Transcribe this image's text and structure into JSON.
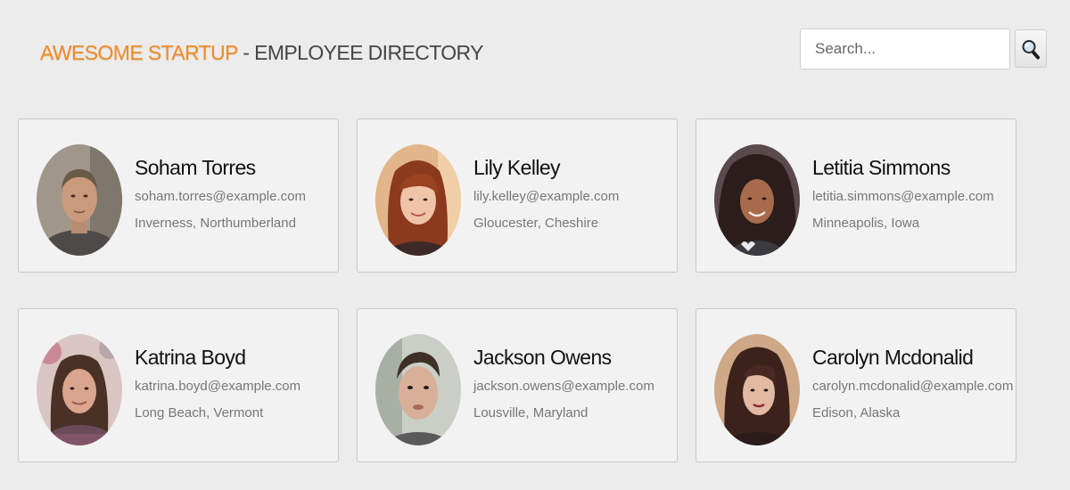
{
  "header": {
    "brand": "AWESOME STARTUP",
    "separator": " - ",
    "title": "EMPLOYEE DIRECTORY"
  },
  "search": {
    "placeholder": "Search...",
    "value": "",
    "icon": "magnifier-icon"
  },
  "colors": {
    "brand": "#f28b26",
    "background": "#ececec",
    "card": "#f2f2f2"
  },
  "employees": [
    {
      "name": "Soham Torres",
      "email": "soham.torres@example.com",
      "location": "Inverness, Northumberland"
    },
    {
      "name": "Lily Kelley",
      "email": "lily.kelley@example.com",
      "location": "Gloucester, Cheshire"
    },
    {
      "name": "Letitia Simmons",
      "email": "letitia.simmons@example.com",
      "location": "Minneapolis, Iowa"
    },
    {
      "name": "Katrina Boyd",
      "email": "katrina.boyd@example.com",
      "location": "Long Beach, Vermont"
    },
    {
      "name": "Jackson Owens",
      "email": "jackson.owens@example.com",
      "location": "Lousville, Maryland"
    },
    {
      "name": "Carolyn Mcdonalid",
      "email": "carolyn.mcdonalid@example.com",
      "location": "Edison, Alaska"
    }
  ]
}
